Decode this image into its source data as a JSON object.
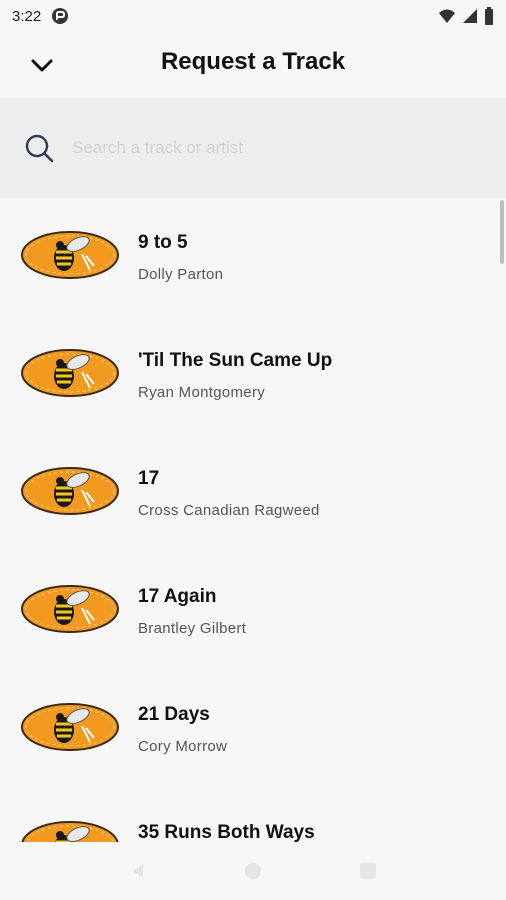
{
  "status_bar": {
    "time": "3:22",
    "icons": [
      "vpn-icon",
      "wifi-icon",
      "signal-icon",
      "battery-icon"
    ]
  },
  "header": {
    "title": "Request a Track",
    "back_icon": "chevron-down-icon"
  },
  "search": {
    "placeholder": "Search a track or artist",
    "value": "",
    "icon": "search-icon"
  },
  "tracks": [
    {
      "title": " 9 to 5",
      "artist": "Dolly Parton"
    },
    {
      "title": "'Til The Sun Came Up",
      "artist": "Ryan Montgomery"
    },
    {
      "title": "17",
      "artist": "Cross Canadian Ragweed"
    },
    {
      "title": "17 Again",
      "artist": "Brantley Gilbert"
    },
    {
      "title": "21 Days",
      "artist": "Cory Morrow"
    },
    {
      "title": "35 Runs Both Ways",
      "artist": ""
    }
  ],
  "nav_bar": {
    "icons": [
      "back-nav-icon",
      "home-nav-icon",
      "recents-nav-icon"
    ]
  },
  "colors": {
    "logo_orange": "#f29a1f",
    "background": "#f7f7f7",
    "search_bg": "#ededed"
  }
}
